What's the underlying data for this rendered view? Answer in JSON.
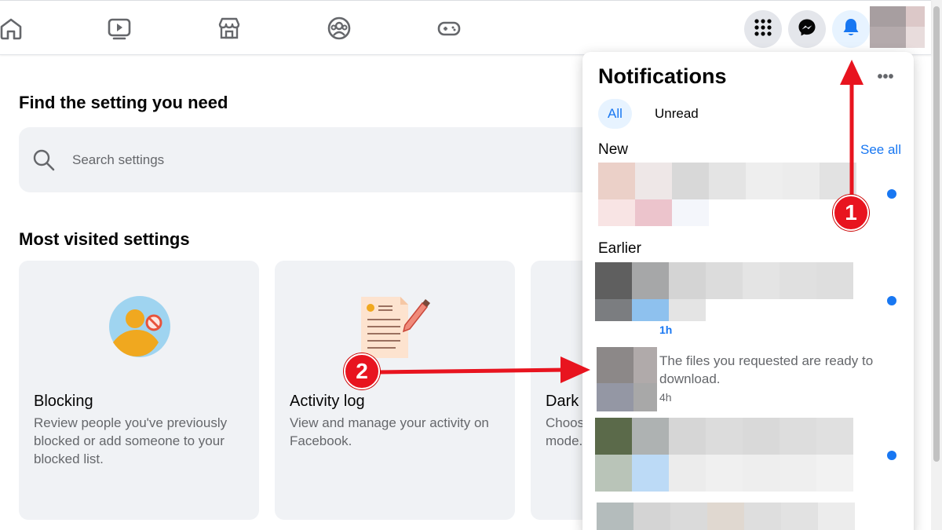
{
  "nav": {
    "icons": [
      "home-icon",
      "watch-icon",
      "marketplace-icon",
      "groups-icon",
      "gaming-icon"
    ],
    "right_buttons": [
      "menu-grid-icon",
      "messenger-icon",
      "bell-icon"
    ]
  },
  "settings": {
    "find_title": "Find the setting you need",
    "search_placeholder": "Search settings",
    "most_visited_title": "Most visited settings",
    "cards": [
      {
        "title": "Blocking",
        "desc": "Review people you've previously blocked or add someone to your blocked list."
      },
      {
        "title": "Activity log",
        "desc": "View and manage your activity on Facebook."
      },
      {
        "title": "Dark",
        "desc": "Choos mode."
      }
    ]
  },
  "notifications": {
    "title": "Notifications",
    "more_label": "•••",
    "tabs": {
      "all": "All",
      "unread": "Unread"
    },
    "new_label": "New",
    "see_all": "See all",
    "earlier_label": "Earlier",
    "items": [
      {
        "time": "1h"
      },
      {
        "text": "The files you requested are ready to download.",
        "time": "4h"
      }
    ]
  },
  "annotations": {
    "badge1": "1",
    "badge2": "2"
  },
  "colors": {
    "accent": "#1877f2",
    "annotation_red": "#e8141f",
    "card_bg": "#f0f2f5"
  }
}
